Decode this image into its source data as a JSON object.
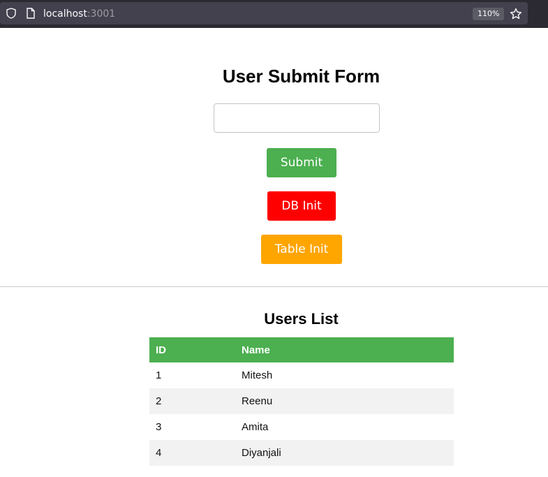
{
  "browser": {
    "url_host": "localhost",
    "url_port": ":3001",
    "zoom": "110%"
  },
  "form": {
    "title": "User Submit Form",
    "input_value": "",
    "submit_label": "Submit",
    "db_init_label": "DB Init",
    "table_init_label": "Table Init"
  },
  "users": {
    "title": "Users List",
    "columns": [
      "ID",
      "Name"
    ],
    "rows": [
      {
        "id": "1",
        "name": "Mitesh"
      },
      {
        "id": "2",
        "name": "Reenu"
      },
      {
        "id": "3",
        "name": "Amita"
      },
      {
        "id": "4",
        "name": "Diyanjali"
      }
    ]
  },
  "colors": {
    "submit": "#4caf50",
    "db_init": "#ff0000",
    "table_init": "#ffa500",
    "table_header": "#4caf50"
  }
}
